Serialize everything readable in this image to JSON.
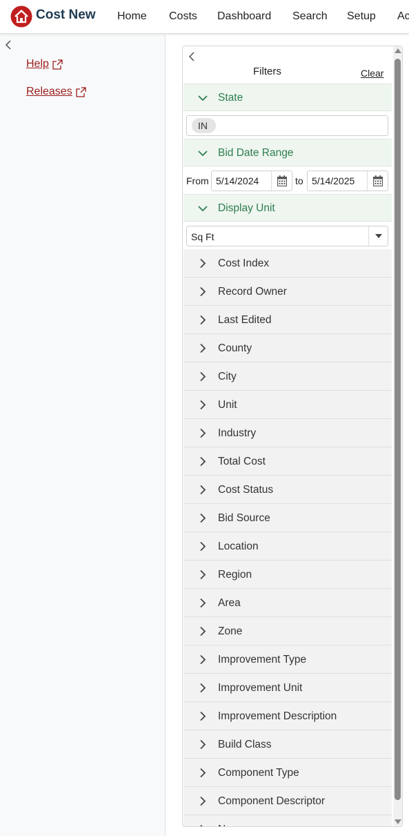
{
  "app": {
    "title": "Cost New"
  },
  "nav": [
    "Home",
    "Costs",
    "Dashboard",
    "Search",
    "Setup",
    "Ac"
  ],
  "sidebar": {
    "links": [
      {
        "label": "Help",
        "icon": "external-link-icon"
      },
      {
        "label": "Releases",
        "icon": "external-link-icon"
      }
    ]
  },
  "filters": {
    "title": "Filters",
    "clear_label": "Clear",
    "sections": {
      "state": {
        "label": "State",
        "chip": "IN"
      },
      "bid_date_range": {
        "label": "Bid Date Range",
        "from_label": "From",
        "to_label": "to",
        "from_value": "5/14/2024",
        "to_value": "5/14/2025"
      },
      "display_unit": {
        "label": "Display Unit",
        "value": "Sq Ft"
      }
    },
    "collapsed": [
      "Cost Index",
      "Record Owner",
      "Last Edited",
      "County",
      "City",
      "Unit",
      "Industry",
      "Total Cost",
      "Cost Status",
      "Bid Source",
      "Location",
      "Region",
      "Area",
      "Zone",
      "Improvement Type",
      "Improvement Unit",
      "Improvement Description",
      "Build Class",
      "Component Type",
      "Component Descriptor",
      "N..."
    ]
  },
  "colors": {
    "brand_red": "#c01f1f",
    "section_green": "#2e7d4f",
    "link_red": "#9b1c1c"
  }
}
